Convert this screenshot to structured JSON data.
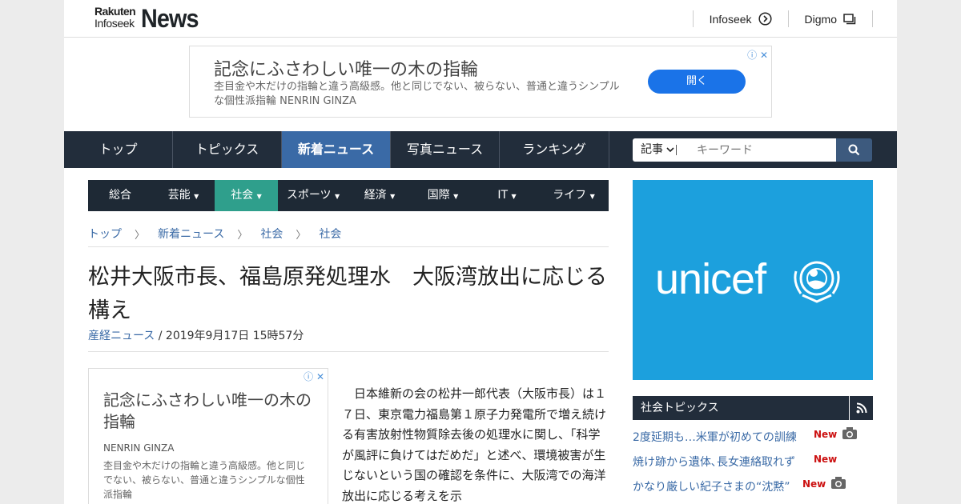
{
  "header": {
    "logo_rakuten": "Rakuten",
    "logo_infoseek": "Infoseek",
    "logo_news": "News",
    "links": [
      {
        "label": "Infoseek",
        "icon": "arrow-circle-icon"
      },
      {
        "label": "Digmo",
        "icon": "window-icon"
      }
    ]
  },
  "top_ad": {
    "title": "記念にふさわしい唯一の木の指輪",
    "description": "杢目金や木だけの指輪と違う高級感。他と同じでない、被らない、普通と違うシンプルな個性派指輪 NENRIN GINZA",
    "button": "開く"
  },
  "nav": {
    "tabs": [
      "トップ",
      "トピックス",
      "新着ニュース",
      "写真ニュース",
      "ランキング"
    ],
    "active": "新着ニュース",
    "search": {
      "select_label": "記事",
      "placeholder": "キーワード"
    }
  },
  "subnav": {
    "items": [
      "総合",
      "芸能",
      "社会",
      "スポーツ",
      "経済",
      "国際",
      "IT",
      "ライフ"
    ],
    "active": "社会"
  },
  "breadcrumb": [
    "トップ",
    "新着ニュース",
    "社会",
    "社会"
  ],
  "article": {
    "title": "松井大阪市長、福島原発処理水　大阪湾放出に応じる構え",
    "source": "産経ニュース",
    "date": " / 2019年9月17日 15時57分",
    "body": "日本維新の会の松井一郎代表（大阪市長）は１７日、東京電力福島第１原子力発電所で増え続ける有害放射性物質除去後の処理水に関し、「科学が風評に負けてはだめだ」と述べ、環境被害が生じないという国の確認を条件に、大阪湾での海洋放出に応じる考えを示"
  },
  "inline_ad": {
    "title": "記念にふさわしい唯一の木の指輪",
    "brand": "NENRIN GINZA",
    "description": "杢目金や木だけの指輪と違う高級感。他と同じでない、被らない、普通と違うシンプルな個性派指輪"
  },
  "side_ad": {
    "brand": "unicef"
  },
  "topics": {
    "heading": "社会トピックス",
    "items": [
      {
        "title": "2度延期も…米軍が初めての訓練",
        "badge": "New"
      },
      {
        "title": "焼け跡から遺体､長女連絡取れず",
        "badge": "New"
      },
      {
        "title": "かなり厳しい紀子さまの“沈黙”",
        "badge": "New"
      }
    ]
  },
  "colors": {
    "nav_bg": "#222d3b",
    "nav_active": "#3a6aa6",
    "subnav_active": "#2f9f8c",
    "link": "#3a6aa6",
    "unicef": "#1ca0dd",
    "new_badge": "#cc1111"
  }
}
